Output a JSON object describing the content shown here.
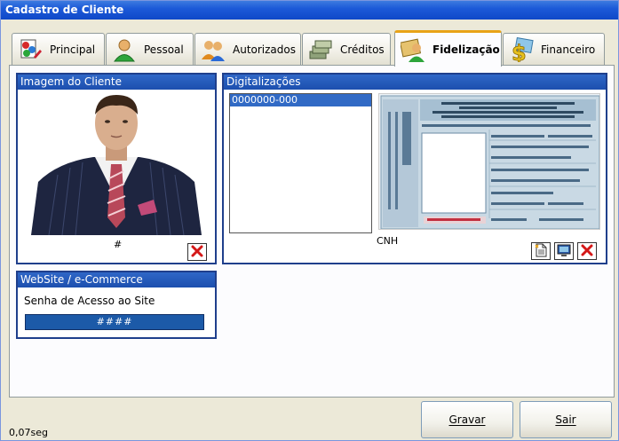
{
  "window": {
    "title": "Cadastro de Cliente"
  },
  "tabs": [
    {
      "label": "Principal",
      "icon": "document-colors-icon"
    },
    {
      "label": "Pessoal",
      "icon": "person-icon"
    },
    {
      "label": "Autorizados",
      "icon": "people-icon"
    },
    {
      "label": "Créditos",
      "icon": "money-stack-icon"
    },
    {
      "label": "Fidelização",
      "icon": "person-card-icon",
      "active": true
    },
    {
      "label": "Financeiro",
      "icon": "dollar-icon"
    }
  ],
  "cliente": {
    "title": "Imagem do Cliente",
    "caption": "#"
  },
  "digitalizacoes": {
    "title": "Digitalizações",
    "items": [
      "0000000-000"
    ],
    "caption": "CNH"
  },
  "website": {
    "title": "WebSite / e-Commerce",
    "label": "Senha de Acesso ao Site",
    "password": "####"
  },
  "buttons": {
    "gravar": "Gravar",
    "sair": "Sair"
  },
  "status": "0,07seg",
  "colors": {
    "titlebar": "#1c5ad8",
    "group_header": "#1c4fae",
    "active_tab_accent": "#e8a317",
    "selection": "#316ac5"
  }
}
